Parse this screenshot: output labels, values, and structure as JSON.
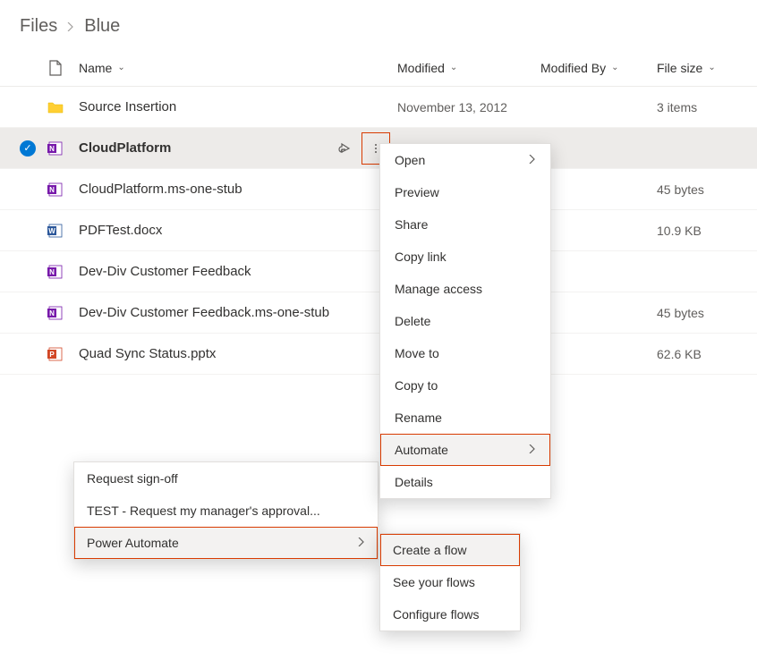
{
  "breadcrumb": {
    "root": "Files",
    "current": "Blue"
  },
  "columns": {
    "name": "Name",
    "modified": "Modified",
    "modifiedBy": "Modified By",
    "fileSize": "File size"
  },
  "rows": [
    {
      "name": "Source Insertion",
      "type": "folder",
      "modified": "November 13, 2012",
      "modifiedBy": "",
      "size": "3 items",
      "selected": false
    },
    {
      "name": "CloudPlatform",
      "type": "onenote",
      "modified": "",
      "modifiedBy": "",
      "size": "",
      "selected": true
    },
    {
      "name": "CloudPlatform.ms-one-stub",
      "type": "onenote",
      "modified": "",
      "modifiedBy": "",
      "size": "45 bytes",
      "selected": false
    },
    {
      "name": "PDFTest.docx",
      "type": "word",
      "modified": "",
      "modifiedBy": "",
      "size": "10.9 KB",
      "selected": false
    },
    {
      "name": "Dev-Div Customer Feedback",
      "type": "onenote",
      "modified": "",
      "modifiedBy": "",
      "size": "",
      "selected": false
    },
    {
      "name": "Dev-Div Customer Feedback.ms-one-stub",
      "type": "onenote",
      "modified": "",
      "modifiedBy": "",
      "size": "45 bytes",
      "selected": false
    },
    {
      "name": "Quad Sync Status.pptx",
      "type": "powerpoint",
      "modified": "",
      "modifiedBy": "",
      "size": "62.6 KB",
      "selected": false
    }
  ],
  "contextMenu": {
    "open": "Open",
    "preview": "Preview",
    "share": "Share",
    "copyLink": "Copy link",
    "manageAccess": "Manage access",
    "delete": "Delete",
    "moveTo": "Move to",
    "copyTo": "Copy to",
    "rename": "Rename",
    "automate": "Automate",
    "details": "Details"
  },
  "automateSubmenu": {
    "requestSignoff": "Request sign-off",
    "testRequest": "TEST - Request my manager's approval...",
    "powerAutomate": "Power Automate"
  },
  "paSubmenu": {
    "createFlow": "Create a flow",
    "seeFlows": "See your flows",
    "configureFlows": "Configure flows"
  }
}
